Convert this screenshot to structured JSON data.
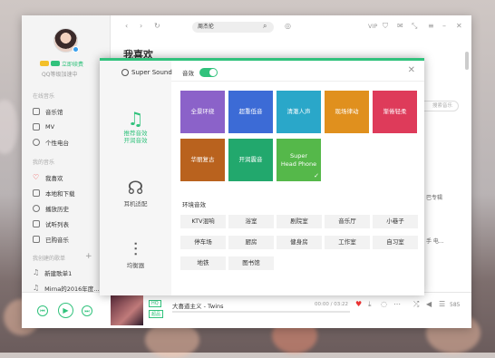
{
  "sidebar": {
    "user": {
      "vip_label": "立即续费",
      "status": "QQ等级加速中"
    },
    "online_section": "在线音乐",
    "online_items": [
      "音乐馆",
      "MV",
      "个性电台"
    ],
    "my_section": "我的音乐",
    "my_items": [
      {
        "icon": "heart-icon",
        "label": "我喜欢"
      },
      {
        "icon": "download-icon",
        "label": "本地和下载"
      },
      {
        "icon": "history-icon",
        "label": "播放历史"
      },
      {
        "icon": "list-icon",
        "label": "试听列表"
      },
      {
        "icon": "cloud-icon",
        "label": "已购音乐"
      }
    ],
    "created_section": "我创建的歌单",
    "playlists": [
      "新建歌单1",
      "Mirna的2016年度..."
    ]
  },
  "topbar": {
    "search_value": "周杰伦",
    "vip": "VIP"
  },
  "background": {
    "page_title": "我喜欢",
    "search_placeholder": "搜索音乐",
    "rows": [
      "巴专辑",
      "手 电..."
    ]
  },
  "player": {
    "song": "大喜道主义 - Twins",
    "quality": "HQ",
    "time": "00:00 / 03:22",
    "count": "585",
    "tag": "超品"
  },
  "dialog": {
    "brand": "Super Sound",
    "nav": [
      {
        "icon": "music-note-icon",
        "label": "推荐音效\n开润音效",
        "active": true
      },
      {
        "icon": "headphones-icon",
        "label": "耳机适配",
        "active": false
      },
      {
        "icon": "equalizer-icon",
        "label": "均衡器",
        "active": false
      }
    ],
    "effect_label": "音效",
    "effect_on": true,
    "tiles": [
      {
        "label": "全景环绕",
        "color": "#8b62c9"
      },
      {
        "label": "超重低音",
        "color": "#3c6bd6"
      },
      {
        "label": "清澈人声",
        "color": "#2aa7c9"
      },
      {
        "label": "现场律动",
        "color": "#e0901e"
      },
      {
        "label": "渐倦轻柔",
        "color": "#de3b5a"
      },
      {
        "label": "华丽复古",
        "color": "#b9621e"
      },
      {
        "label": "开润震音",
        "color": "#22a86d"
      },
      {
        "label": "Super\nHead Phone",
        "color": "#55b84a",
        "checked": true
      }
    ],
    "env_label": "环境音效",
    "env": [
      "KTV混响",
      "浴室",
      "剧院室",
      "音乐厅",
      "小巷子",
      "停车场",
      "厨房",
      "健身房",
      "工作室",
      "自习室",
      "地铁",
      "图书馆"
    ]
  },
  "colors": {
    "accent": "#31c27c"
  }
}
